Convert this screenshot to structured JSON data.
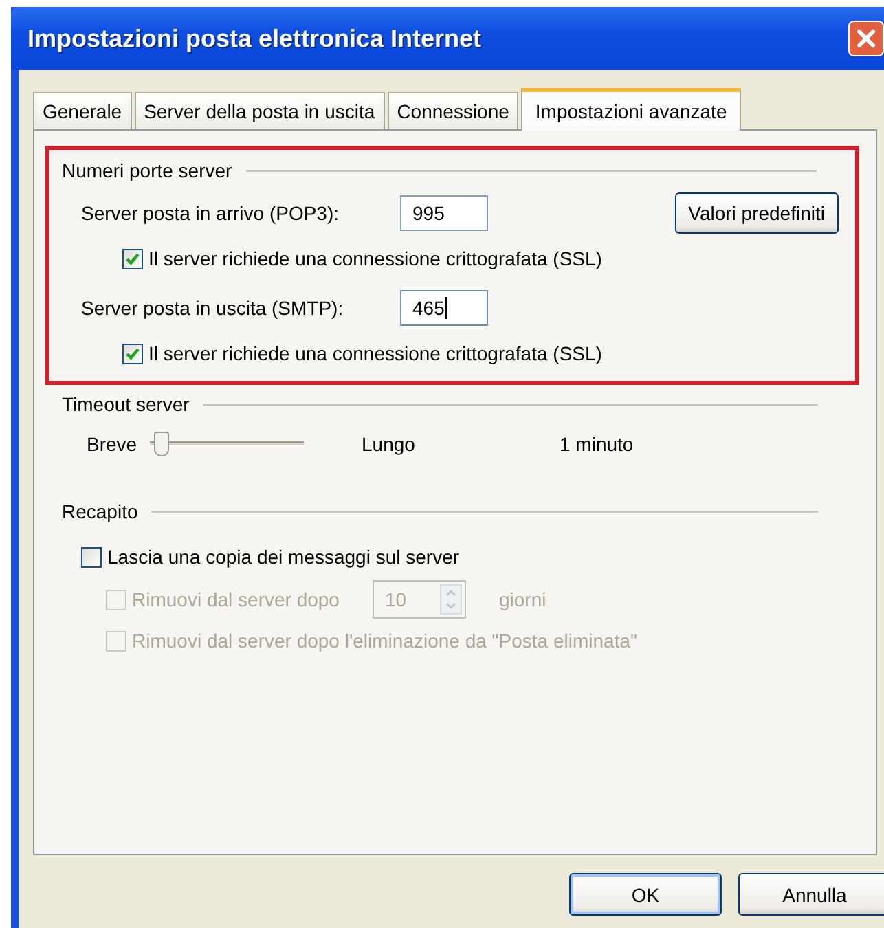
{
  "window": {
    "title": "Impostazioni posta elettronica Internet"
  },
  "tabs": [
    {
      "label": "Generale",
      "selected": false
    },
    {
      "label": "Server della posta in uscita",
      "selected": false
    },
    {
      "label": "Connessione",
      "selected": false
    },
    {
      "label": "Impostazioni avanzate",
      "selected": true
    }
  ],
  "ports": {
    "title": "Numeri porte server",
    "highlighted": true,
    "defaults_button": "Valori predefiniti",
    "servers": [
      {
        "label": "Server posta in arrivo (POP3):",
        "value": "995",
        "focused": false,
        "ssl": {
          "label": "Il server richiede una connessione crittografata (SSL)",
          "checked": true
        }
      },
      {
        "label": "Server posta in uscita (SMTP):",
        "value": "465",
        "focused": true,
        "ssl": {
          "label": "Il server richiede una connessione crittografata (SSL)",
          "checked": true
        }
      }
    ]
  },
  "timeout": {
    "title": "Timeout server",
    "min_label": "Breve",
    "max_label": "Lungo",
    "level": 0.05,
    "reading": "1 minuto"
  },
  "delivery": {
    "title": "Recapito",
    "options": [
      {
        "kind": "checkbox",
        "label": "Lascia una copia dei messaggi sul server",
        "checked": false,
        "disabled": false
      },
      {
        "kind": "spin",
        "label": "Rimuovi dal server dopo",
        "value": "10",
        "unit": "giorni",
        "checked": false,
        "disabled": true
      },
      {
        "kind": "checkbox",
        "label": "Rimuovi dal server dopo l'eliminazione da \"Posta eliminata\"",
        "checked": false,
        "disabled": true
      }
    ]
  },
  "buttons": [
    {
      "label": "OK",
      "default": true
    },
    {
      "label": "Annulla",
      "default": false
    }
  ]
}
